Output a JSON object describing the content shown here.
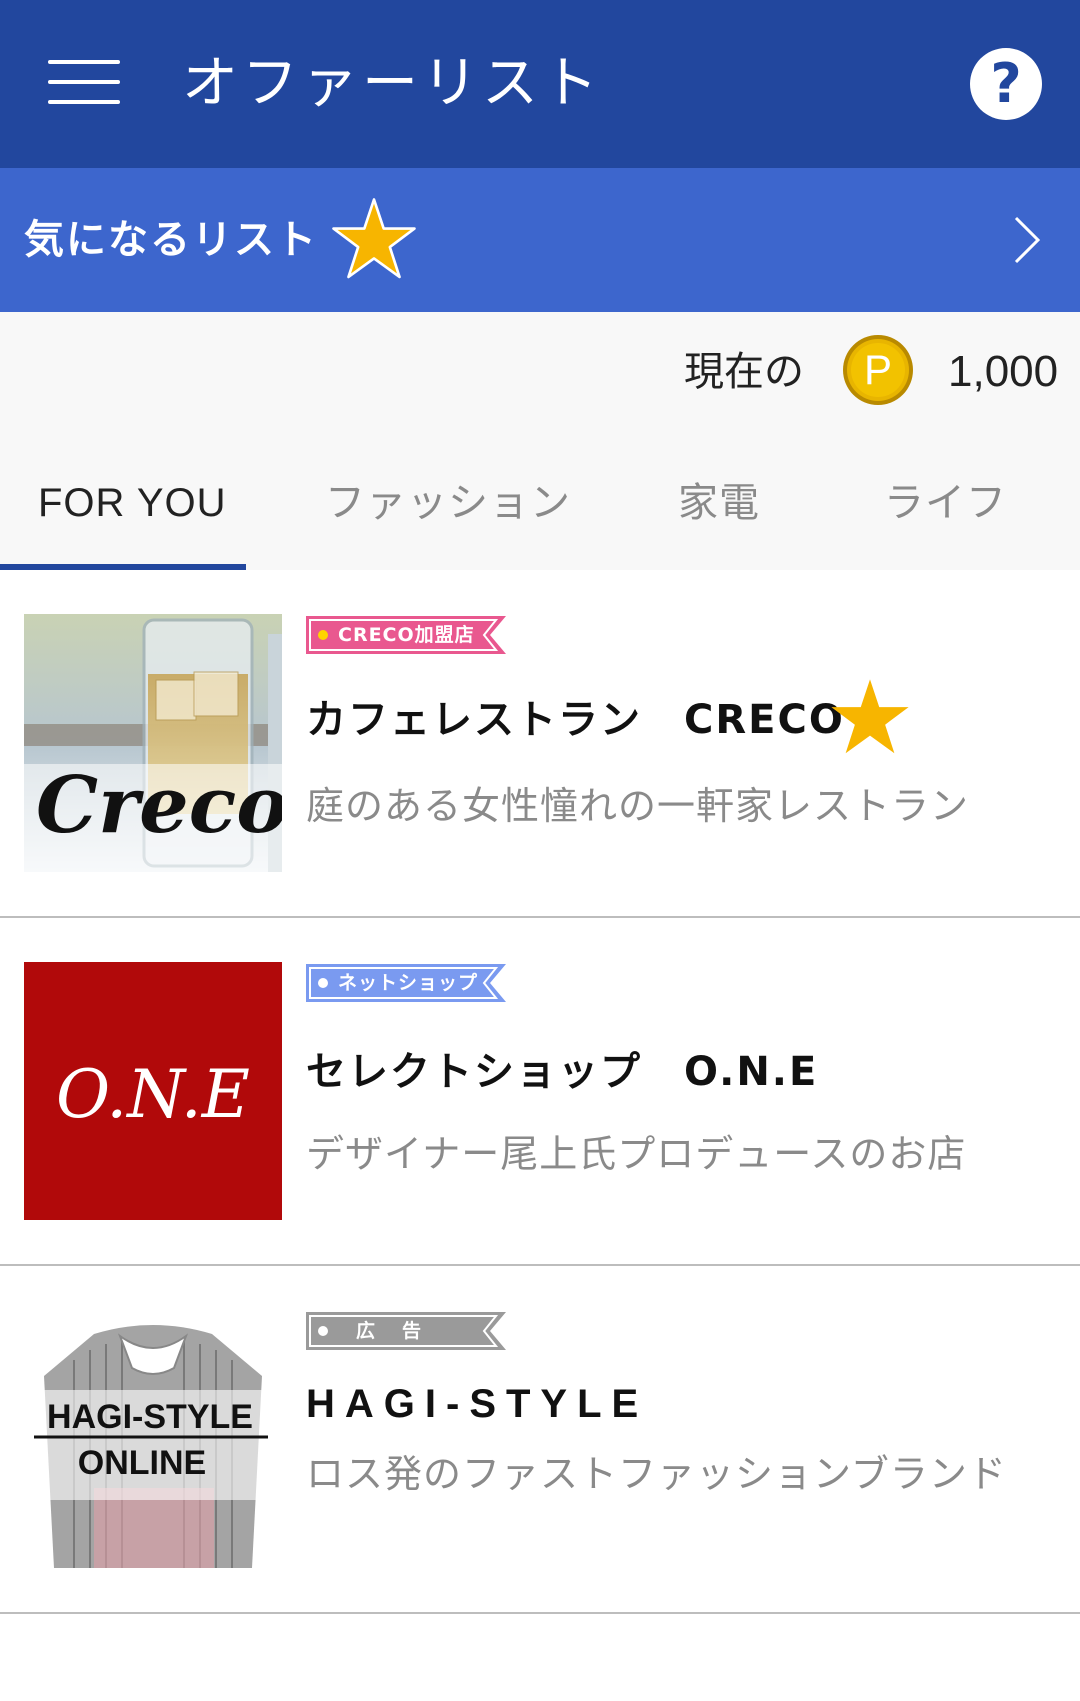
{
  "app_bar": {
    "title": "オファーリスト",
    "help_icon": "question-circle-icon",
    "menu_icon": "hamburger-menu-icon"
  },
  "favorites": {
    "label": "気になるリスト",
    "star_icon": "star-icon",
    "chevron_icon": "chevron-right-icon"
  },
  "points": {
    "label": "現在の",
    "coin_letter": "P",
    "value": "1,000"
  },
  "tabs": [
    {
      "label": "FOR YOU",
      "active": true
    },
    {
      "label": "ファッション",
      "active": false
    },
    {
      "label": "家電",
      "active": false
    },
    {
      "label": "ライフ",
      "active": false
    }
  ],
  "offers": [
    {
      "badge": "CRECO加盟店",
      "badge_color": "#e9588f",
      "title": "カフェレストラン　CRECO",
      "favorited": true,
      "description": "庭のある女性憧れの一軒家レストラン",
      "thumb_text": "Creco"
    },
    {
      "badge": "ネットショップ",
      "badge_color": "#7a9af0",
      "title": "セレクトショップ　O.N.E",
      "favorited": false,
      "description": "デザイナー尾上氏プロデュースのお店",
      "thumb_text": "O.N.E"
    },
    {
      "badge": "広　告",
      "badge_color": "#9a9a9a",
      "title": "HAGI-STYLE",
      "favorited": false,
      "description": "ロス発のファストファッションブランド",
      "thumb_text_line1": "HAGI-STYLE",
      "thumb_text_line2": "ONLINE"
    }
  ],
  "colors": {
    "appbar": "#22479e",
    "favbar": "#3d66cd",
    "star": "#f7b500",
    "coin": "#d8a400",
    "tab_indicator": "#22479e"
  }
}
